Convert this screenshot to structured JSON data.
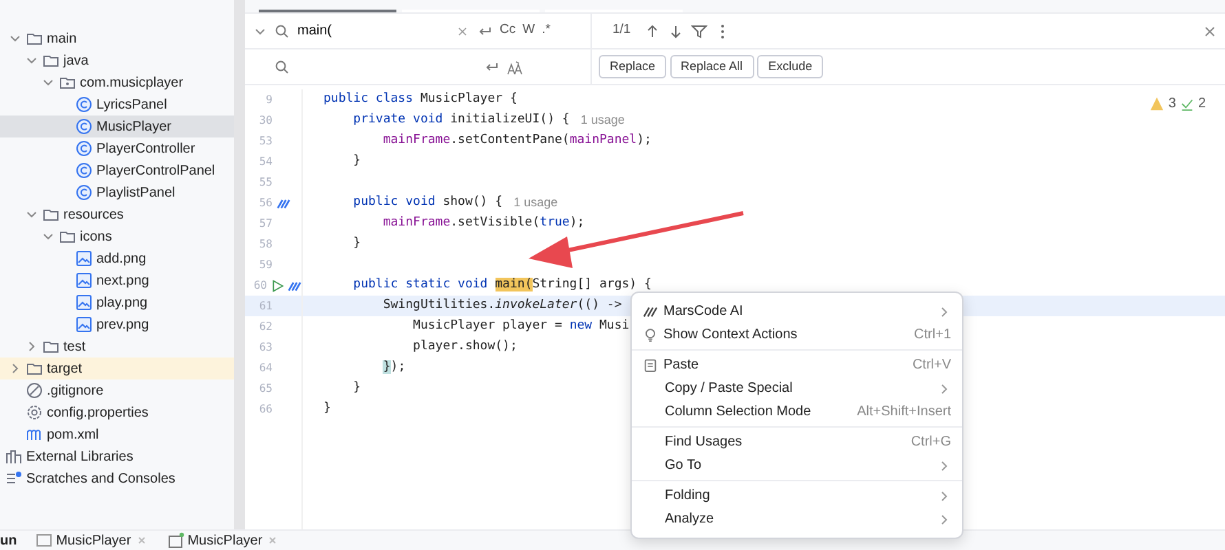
{
  "project_tree": [
    {
      "label": "main",
      "kind": "folder",
      "expanded": true,
      "selected": false,
      "highlight": false,
      "children": [
        {
          "label": "java",
          "kind": "folder",
          "expanded": true,
          "selected": false,
          "highlight": false,
          "children": [
            {
              "label": "com.musicplayer",
              "kind": "package",
              "expanded": true,
              "selected": false,
              "highlight": false,
              "children": [
                {
                  "label": "LyricsPanel",
                  "kind": "class",
                  "selected": false,
                  "highlight": false
                },
                {
                  "label": "MusicPlayer",
                  "kind": "class",
                  "selected": true,
                  "highlight": false
                },
                {
                  "label": "PlayerController",
                  "kind": "class",
                  "selected": false,
                  "highlight": false
                },
                {
                  "label": "PlayerControlPanel",
                  "kind": "class",
                  "selected": false,
                  "highlight": false
                },
                {
                  "label": "PlaylistPanel",
                  "kind": "class",
                  "selected": false,
                  "highlight": false
                }
              ]
            }
          ]
        },
        {
          "label": "resources",
          "kind": "folder",
          "expanded": true,
          "selected": false,
          "highlight": false,
          "children": [
            {
              "label": "icons",
              "kind": "folder",
              "expanded": true,
              "selected": false,
              "highlight": false,
              "children": [
                {
                  "label": "add.png",
                  "kind": "image",
                  "selected": false,
                  "highlight": false
                },
                {
                  "label": "next.png",
                  "kind": "image",
                  "selected": false,
                  "highlight": false
                },
                {
                  "label": "play.png",
                  "kind": "image",
                  "selected": false,
                  "highlight": false
                },
                {
                  "label": "prev.png",
                  "kind": "image",
                  "selected": false,
                  "highlight": false
                }
              ]
            }
          ]
        },
        {
          "label": "test",
          "kind": "folder",
          "expanded": false,
          "selected": false,
          "highlight": false
        }
      ]
    },
    {
      "label": "target",
      "kind": "folder",
      "expanded": false,
      "selected": false,
      "highlight": true
    },
    {
      "label": ".gitignore",
      "kind": "ignore",
      "selected": false,
      "highlight": false
    },
    {
      "label": "config.properties",
      "kind": "settings",
      "selected": false,
      "highlight": false
    },
    {
      "label": "pom.xml",
      "kind": "maven",
      "selected": false,
      "highlight": false
    }
  ],
  "editor_tabs": [
    {
      "selected": true
    },
    {
      "selected": false
    },
    {
      "selected": false
    }
  ],
  "tree_roots": [
    {
      "label": "External Libraries",
      "kind": "library"
    },
    {
      "label": "Scratches and Consoles",
      "kind": "scratch"
    }
  ],
  "find": {
    "value": "main(",
    "options": [
      "Cc",
      "W",
      ".*"
    ],
    "count": "1/1"
  },
  "replace": {
    "buttons": [
      "Replace",
      "Replace All",
      "Exclude"
    ]
  },
  "inspections": {
    "warnings": "3",
    "checks": "2"
  },
  "code": [
    {
      "n": "9",
      "current": false,
      "tokens": [
        {
          "kind": "kw",
          "text": "public class "
        },
        {
          "kind": "plain",
          "text": "MusicPlayer {"
        }
      ]
    },
    {
      "n": "30",
      "current": false,
      "tokens": [
        {
          "kind": "kw",
          "text": "    private void "
        },
        {
          "kind": "plain",
          "text": "initializeUI() {"
        }
      ],
      "hint": "1 usage"
    },
    {
      "n": "53",
      "current": false,
      "tokens": [
        {
          "kind": "field",
          "text": "        mainFrame"
        },
        {
          "kind": "plain",
          "text": ".setContentPane("
        },
        {
          "kind": "field",
          "text": "mainPanel"
        },
        {
          "kind": "plain",
          "text": ");"
        }
      ]
    },
    {
      "n": "54",
      "current": false,
      "tokens": [
        {
          "kind": "plain",
          "text": "    }"
        }
      ]
    },
    {
      "n": "55",
      "current": false
    },
    {
      "n": "56",
      "ai_marker": true,
      "current": false,
      "tokens": [
        {
          "kind": "kw",
          "text": "    public void "
        },
        {
          "kind": "plain",
          "text": "show() {"
        }
      ],
      "hint": "1 usage"
    },
    {
      "n": "57",
      "current": false,
      "tokens": [
        {
          "kind": "field",
          "text": "        mainFrame"
        },
        {
          "kind": "plain",
          "text": ".setVisible("
        },
        {
          "kind": "kw",
          "text": "true"
        },
        {
          "kind": "plain",
          "text": ");"
        }
      ]
    },
    {
      "n": "58",
      "current": false,
      "tokens": [
        {
          "kind": "plain",
          "text": "    }"
        }
      ]
    },
    {
      "n": "59",
      "current": false
    },
    {
      "n": "60",
      "run_marker": true,
      "ai_marker": true,
      "current": false,
      "tokens": [
        {
          "kind": "kw",
          "text": "    public static void "
        },
        {
          "kind": "match",
          "text": "main("
        },
        {
          "kind": "plain",
          "text": "String[] args) {"
        }
      ]
    },
    {
      "n": "61",
      "current": true,
      "tokens": [
        {
          "kind": "plain",
          "text": "        SwingUtilities."
        },
        {
          "kind": "italic",
          "text": "invokeLater"
        },
        {
          "kind": "plain",
          "text": "(() ->"
        }
      ]
    },
    {
      "n": "62",
      "current": false,
      "tokens": [
        {
          "kind": "plain",
          "text": "            MusicPlayer player = "
        },
        {
          "kind": "kw",
          "text": "new"
        },
        {
          "kind": "plain",
          "text": " Musi"
        }
      ]
    },
    {
      "n": "63",
      "current": false,
      "tokens": [
        {
          "kind": "plain",
          "text": "            player.show();"
        }
      ]
    },
    {
      "n": "64",
      "current": false,
      "tokens": [
        {
          "kind": "brace",
          "text": "        }"
        },
        {
          "kind": "plain",
          "text": ");"
        }
      ]
    },
    {
      "n": "65",
      "current": false,
      "tokens": [
        {
          "kind": "plain",
          "text": "    }"
        }
      ]
    },
    {
      "n": "66",
      "current": false,
      "tokens": [
        {
          "kind": "plain",
          "text": "}"
        }
      ]
    }
  ],
  "context_menu": [
    [
      {
        "label": "MarsCode AI",
        "kind": "ai",
        "submenu": true
      },
      {
        "label": "Show Context Actions",
        "kind": "bulb",
        "shortcut": "Ctrl+1",
        "submenu": false
      }
    ],
    [
      {
        "label": "Paste",
        "kind": "clipboard",
        "shortcut": "Ctrl+V",
        "submenu": false
      },
      {
        "label": "Copy / Paste Special",
        "submenu": true
      },
      {
        "label": "Column Selection Mode",
        "shortcut": "Alt+Shift+Insert",
        "submenu": false
      }
    ],
    [
      {
        "label": "Find Usages",
        "shortcut": "Ctrl+G",
        "submenu": false
      },
      {
        "label": "Go To",
        "submenu": true
      }
    ],
    [
      {
        "label": "Folding",
        "submenu": true
      },
      {
        "label": "Analyze",
        "submenu": true
      }
    ]
  ],
  "bottom_bar": {
    "label": "un",
    "tabs": [
      {
        "label": "MusicPlayer",
        "kind": "window"
      },
      {
        "label": "MusicPlayer",
        "kind": "app"
      }
    ]
  }
}
